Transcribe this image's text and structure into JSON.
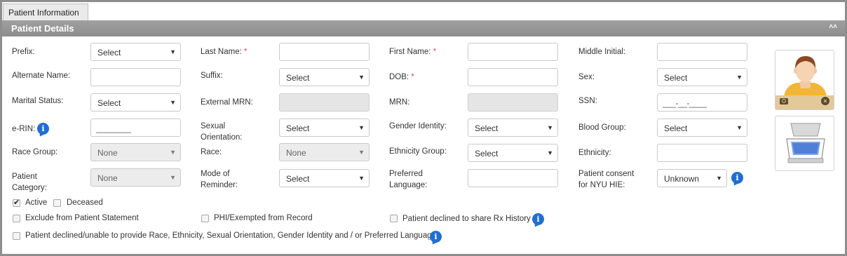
{
  "tab": {
    "label": "Patient Information"
  },
  "section": {
    "title": "Patient Details",
    "collapse_glyph": "˄˄"
  },
  "select_default": "Select",
  "none_default": "None",
  "labels": {
    "prefix": "Prefix:",
    "last_name": "Last Name:",
    "first_name": "First Name:",
    "middle_initial": "Middle Initial:",
    "alternate_name": "Alternate Name:",
    "suffix": "Suffix:",
    "dob": "DOB:",
    "sex": "Sex:",
    "marital_status": "Marital Status:",
    "external_mrn": "External MRN:",
    "mrn": "MRN:",
    "ssn": "SSN:",
    "erin": "e-RIN:",
    "sexual_orientation_1": "Sexual",
    "sexual_orientation_2": "Orientation:",
    "gender_identity": "Gender Identity:",
    "blood_group": "Blood Group:",
    "race_group": "Race Group:",
    "race": "Race:",
    "ethnicity_group": "Ethnicity Group:",
    "ethnicity": "Ethnicity:",
    "patient_category_1": "Patient",
    "patient_category_2": "Category:",
    "mode_reminder_1": "Mode of",
    "mode_reminder_2": "Reminder:",
    "preferred_language_1": "Preferred",
    "preferred_language_2": "Language:",
    "consent_1": "Patient consent",
    "consent_2": "for NYU HIE:",
    "required_mark": "*"
  },
  "values": {
    "ssn_mask": "___-__-____",
    "erin_mask": "________",
    "consent": "Unknown"
  },
  "checkboxes": {
    "active": {
      "label": "Active",
      "checked": true
    },
    "deceased": {
      "label": "Deceased",
      "checked": false
    },
    "exclude_statement": {
      "label": "Exclude from Patient Statement",
      "checked": false
    },
    "phi_exempted": {
      "label": "PHI/Exempted from Record",
      "checked": false
    },
    "declined_rx": {
      "label": "Patient declined to share Rx History",
      "checked": false
    },
    "declined_race": {
      "label": "Patient declined/unable to provide Race, Ethnicity, Sexual Orientation, Gender Identity and / or Preferred Language.",
      "checked": false
    }
  },
  "icons": {
    "info": "info-icon",
    "photo": "patient-photo-icon",
    "scanner": "scanner-icon",
    "camera": "camera-icon",
    "remove": "remove-photo-icon"
  },
  "colors": {
    "section_bar": "#999999",
    "info": "#1f6fd1",
    "required": "#d9534f",
    "photo_bar": "#e3c89a"
  }
}
